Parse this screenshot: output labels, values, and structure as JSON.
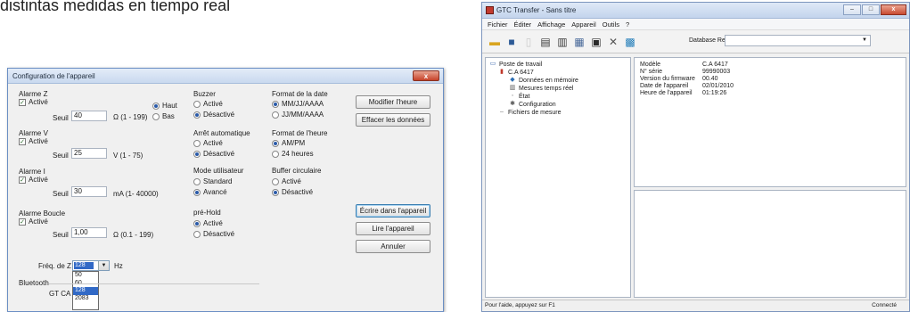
{
  "caption": "distintas medidas en tiempo real",
  "dialog": {
    "title": "Configuration de l'appareil",
    "close_label": "x",
    "alarm_z": {
      "title": "Alarme Z",
      "active_label": "Activé",
      "seuil_label": "Seuil",
      "seuil_value": "40",
      "range": "Ω (1 - 199)",
      "haut_label": "Haut",
      "bas_label": "Bas"
    },
    "alarm_v": {
      "title": "Alarme V",
      "active_label": "Activé",
      "seuil_label": "Seuil",
      "seuil_value": "25",
      "range": "V (1 - 75)"
    },
    "alarm_i": {
      "title": "Alarme I",
      "active_label": "Activé",
      "seuil_label": "Seuil",
      "seuil_value": "30",
      "range": "mA (1- 40000)"
    },
    "alarm_boucle": {
      "title": "Alarme Boucle",
      "active_label": "Activé",
      "seuil_label": "Seuil",
      "seuil_value": "1,00",
      "range": "Ω (0.1 - 199)"
    },
    "buzzer": {
      "title": "Buzzer",
      "opt1": "Activé",
      "opt2": "Désactivé"
    },
    "auto_stop": {
      "title": "Arrêt automatique",
      "opt1": "Activé",
      "opt2": "Désactivé"
    },
    "user_mode": {
      "title": "Mode utilisateur",
      "opt1": "Standard",
      "opt2": "Avancé"
    },
    "preheld": {
      "title": "pré-Hold",
      "opt1": "Activé",
      "opt2": "Désactivé"
    },
    "date_format": {
      "title": "Format de la date",
      "opt1": "MM/JJ/AAAA",
      "opt2": "JJ/MM/AAAA"
    },
    "time_format": {
      "title": "Format de l'heure",
      "opt1": "AM/PM",
      "opt2": "24 heures"
    },
    "circular_buffer": {
      "title": "Buffer circulaire",
      "opt1": "Activé",
      "opt2": "Désactivé"
    },
    "buttons": {
      "modify_time": "Modifier l'heure",
      "erase_data": "Effacer les données",
      "write_device": "Écrire dans l'appareil",
      "read_device": "Lire l'appareil",
      "cancel": "Annuler"
    },
    "freq": {
      "label": "Fréq. de Z",
      "selected": "128",
      "unit": "Hz",
      "options": [
        "50",
        "60",
        "128",
        "2083"
      ]
    },
    "bluetooth": {
      "label": "Bluetooth",
      "value": "GT CA"
    }
  },
  "app": {
    "title": "GTC Transfer - Sans titre",
    "window_controls": {
      "min": "–",
      "max": "□",
      "close": "x"
    },
    "menu": [
      "Fichier",
      "Éditer",
      "Affichage",
      "Appareil",
      "Outils",
      "?"
    ],
    "toolbar_icons": [
      "open-folder-icon",
      "save-icon",
      "blank-page-icon",
      "print-icon",
      "print-preview-icon",
      "device-icon",
      "connect-icon",
      "tools-icon",
      "monitor-icon"
    ],
    "database_label": "Database Report",
    "database_value": "",
    "tree": {
      "root": "Poste de travail",
      "device": "C.A 6417",
      "children": [
        "Données en mémoire",
        "Mesures temps réel",
        "État",
        "Configuration"
      ],
      "records": "Fichiers de mesure"
    },
    "info": [
      {
        "key": "Modèle",
        "value": "C.A 6417"
      },
      {
        "key": "N° série",
        "value": "99990003"
      },
      {
        "key": "Version du firmware",
        "value": "00.40"
      },
      {
        "key": "Date de l'appareil",
        "value": "02/01/2010"
      },
      {
        "key": "Heure de l'appareil",
        "value": "01:19:26"
      }
    ],
    "status_left": "Pour l'aide, appuyez sur F1",
    "status_right": "Connecté"
  }
}
